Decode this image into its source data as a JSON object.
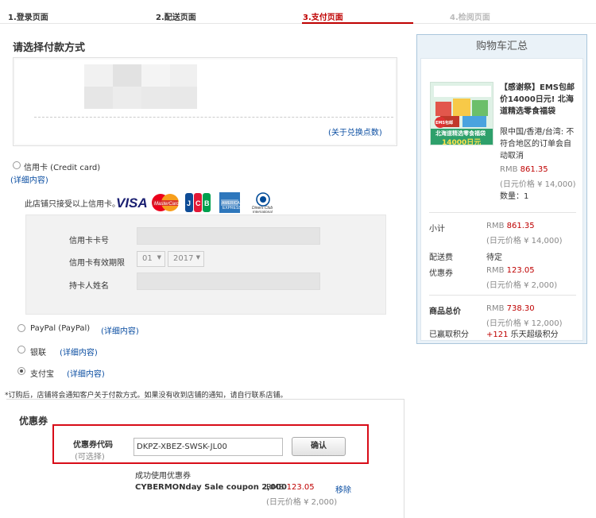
{
  "steps": [
    {
      "label": "1.登录页面",
      "state": "done"
    },
    {
      "label": "2.配送页面",
      "state": "done"
    },
    {
      "label": "3.支付页面",
      "state": "active"
    },
    {
      "label": "4.检阅页面",
      "state": "future"
    }
  ],
  "payment": {
    "heading": "请选择付款方式",
    "points_link": "(关于兑换点数)",
    "credit_card": {
      "label": "信用卡 (Credit card)",
      "details_link": "(详细内容)",
      "accepted_text": "此店铺只接受以上信用卡。",
      "card_brands": [
        "VISA",
        "MasterCard",
        "JCB",
        "American Express",
        "Diners Club International"
      ],
      "number_label": "信用卡卡号",
      "expiry_label": "信用卡有效期限",
      "expiry_month": "01",
      "expiry_year": "2017",
      "holder_label": "持卡人姓名"
    },
    "paypal": {
      "label": "PayPal (PayPal)",
      "details_link": "(详细内容)"
    },
    "unionpay": {
      "label": "银联",
      "details_link": "(详细内容)"
    },
    "alipay": {
      "label": "支付宝",
      "details_link": "(详细内容)",
      "selected": true
    },
    "notice": "*订购后，店铺将会通知客户关于付款方式。如果没有收到店铺的通知，请自行联系店铺。"
  },
  "coupon": {
    "heading": "优惠券",
    "code_label": "优惠券代码",
    "optional_label": "(可选择)",
    "code_value": "DKPZ-XBEZ-SWSK-JL00",
    "confirm_button": "确认",
    "success_text": "成功使用优惠券",
    "coupon_name": "CYBERMONday Sale coupon 2,000",
    "amount_prefix": "RMB",
    "amount": "123.05",
    "amount_jpy": "(日元价格 ¥ 2,000)",
    "remove_link": "移除"
  },
  "summary": {
    "title": "购物车汇总",
    "product": {
      "name": "【感谢祭】EMS包邮价14000日元! 北海道精选零食福袋",
      "note": "限中国/香港/台湾: 不符合地区的订单会自动取消",
      "price_prefix": "RMB",
      "price": "861.35",
      "price_jpy": "(日元价格 ¥ 14,000)",
      "qty": "数量：1",
      "image_text_top": "北海道精选零食福袋",
      "image_text_bottom": "14000日元",
      "image_badge": "EMS包邮"
    },
    "subtotal_label": "小计",
    "subtotal_prefix": "RMB",
    "subtotal": "861.35",
    "subtotal_jpy": "(日元价格 ¥ 14,000)",
    "shipping_label": "配送费",
    "shipping_value": "待定",
    "coupon_label": "优惠券",
    "coupon_prefix": "RMB",
    "coupon_value": "123.05",
    "coupon_jpy": "(日元价格 ¥ 2,000)",
    "total_label": "商品总价",
    "total_prefix": "RMB",
    "total": "738.30",
    "total_jpy": "(日元价格 ¥ 12,000)",
    "points_label": "已赢取积分",
    "points_value": "+121",
    "points_suffix": "乐天超级积分"
  },
  "colors": {
    "accent": "#bf0000",
    "link": "#0b4ea2",
    "highlight_border": "#d80c18",
    "summary_bg": "#eaf2f8"
  }
}
